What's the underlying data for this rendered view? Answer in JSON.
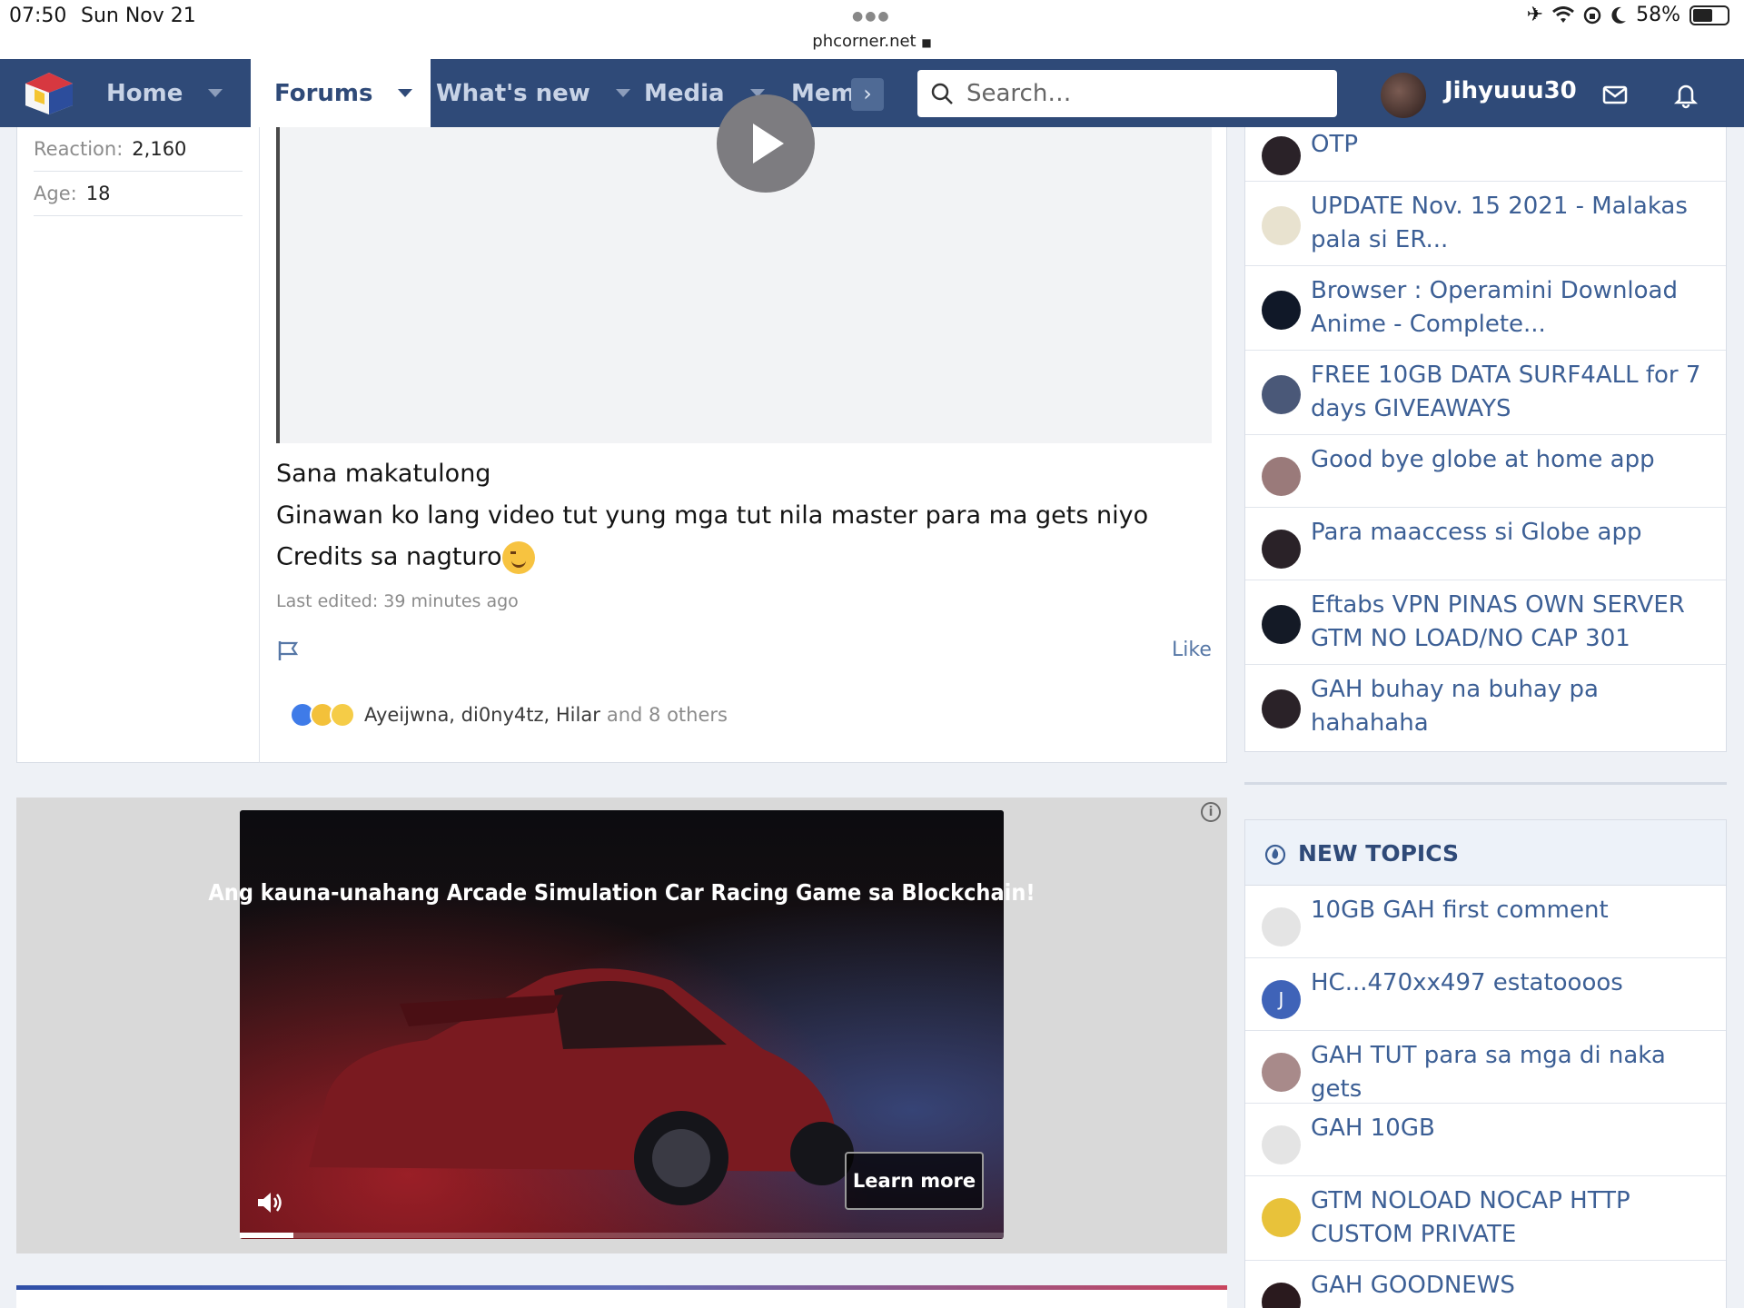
{
  "status_bar": {
    "time": "07:50",
    "date": "Sun Nov 21",
    "battery": "58%",
    "battery_level": 0.58,
    "url": "phcorner.net"
  },
  "nav": {
    "tabs": [
      {
        "label": "Home",
        "active": false
      },
      {
        "label": "Forums",
        "active": true
      },
      {
        "label": "What's new",
        "active": false
      },
      {
        "label": "Media",
        "active": false
      },
      {
        "label": "Mem",
        "active": false
      }
    ],
    "search_placeholder": "Search…",
    "username": "Jihyuuu30",
    "icons": [
      "site-logo-icon",
      "chevron-right-icon",
      "search-icon",
      "envelope-icon",
      "bell-icon"
    ]
  },
  "user_info": [
    {
      "key": "Reaction:",
      "value": "2,160"
    },
    {
      "key": "Age:",
      "value": "18"
    }
  ],
  "post": {
    "lines": [
      "Sana makatulong",
      "Ginawan ko lang video tut yung mga tut nila master para ma gets niyo",
      "Credits sa nagturo"
    ],
    "edited": "Last edited: 39 minutes ago",
    "like_label": "Like",
    "reaction_names": "Ayeijwna, di0ny4tz, Hilar",
    "reaction_others": "and 8 others"
  },
  "ad": {
    "headline": "Ang kauna-unahang Arcade Simulation Car Racing Game sa Blockchain!",
    "button": "Learn more",
    "info_glyph": "i",
    "progress": 0.07
  },
  "sidebar_threads": [
    {
      "title": "Globe at home bypass no need OTP",
      "avatar_color": "#2a2228"
    },
    {
      "title": "UPDATE Nov. 15 2021 - Malakas pala si ER...",
      "avatar_color": "#e8e2cf"
    },
    {
      "title": "Browser : Operamini Download Anime - Complete...",
      "avatar_color": "#101828"
    },
    {
      "title": "FREE 10GB DATA SURF4ALL for 7 days GIVEAWAYS",
      "avatar_color": "#4a5878"
    },
    {
      "title": "Good bye globe at home app",
      "avatar_color": "#9a7a7a"
    },
    {
      "title": "Para maaccess si Globe app",
      "avatar_color": "#2a2228"
    },
    {
      "title": "Eftabs VPN PINAS OWN SERVER GTM NO LOAD/NO CAP 301",
      "avatar_color": "#141a26"
    },
    {
      "title": "GAH buhay na buhay pa hahahaha",
      "avatar_color": "#2a2228"
    }
  ],
  "new_topics": {
    "heading": "NEW TOPICS",
    "items": [
      {
        "title": "10GB GAH first comment",
        "avatar_color": "#e4e4e4",
        "initial": ""
      },
      {
        "title": "HC...470xx497 estatoooos",
        "avatar_color": "#3f63b8",
        "initial": "J"
      },
      {
        "title": "GAH TUT para sa mga di naka gets",
        "avatar_color": "#a88a8a",
        "initial": ""
      },
      {
        "title": "GAH 10GB",
        "avatar_color": "#e4e4e4",
        "initial": ""
      },
      {
        "title": "GTM NOLOAD NOCAP HTTP CUSTOM PRIVATE",
        "avatar_color": "#e8c23a",
        "initial": ""
      },
      {
        "title": "GAH GOODNEWS",
        "avatar_color": "#2a1a1e",
        "initial": ""
      }
    ]
  },
  "colors": {
    "nav_bg": "#2f4a78",
    "link": "#3c5f95",
    "accent": "#5677a6"
  }
}
